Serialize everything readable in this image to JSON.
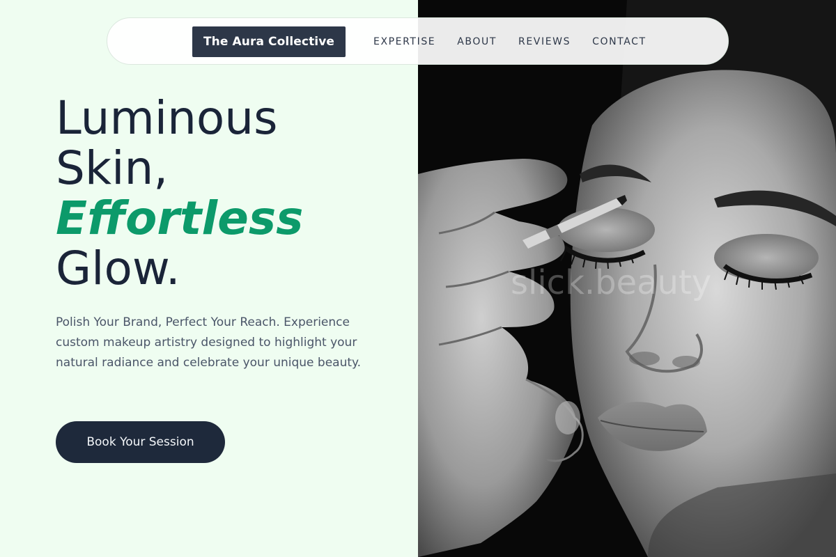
{
  "nav": {
    "brand": "The Aura Collective",
    "links": [
      "EXPERTISE",
      "ABOUT",
      "REVIEWS",
      "CONTACT"
    ]
  },
  "hero": {
    "headline_line1": "Luminous",
    "headline_line2": "Skin,",
    "headline_accent": "Effortless",
    "headline_line4": "Glow.",
    "description": "Polish Your Brand, Perfect Your Reach. Experience custom makeup artistry designed to highlight your natural radiance and celebrate your unique beauty.",
    "cta_label": "Book Your Session"
  },
  "photo": {
    "watermark": "slick.beauty",
    "subject": "black-and-white portrait of makeup artist applying eyeliner to woman with closed eyes"
  },
  "colors": {
    "background": "#effdf1",
    "accent_green": "#0c9a6a",
    "dark_navy": "#1e293b",
    "brand_bg": "#2d3748"
  }
}
